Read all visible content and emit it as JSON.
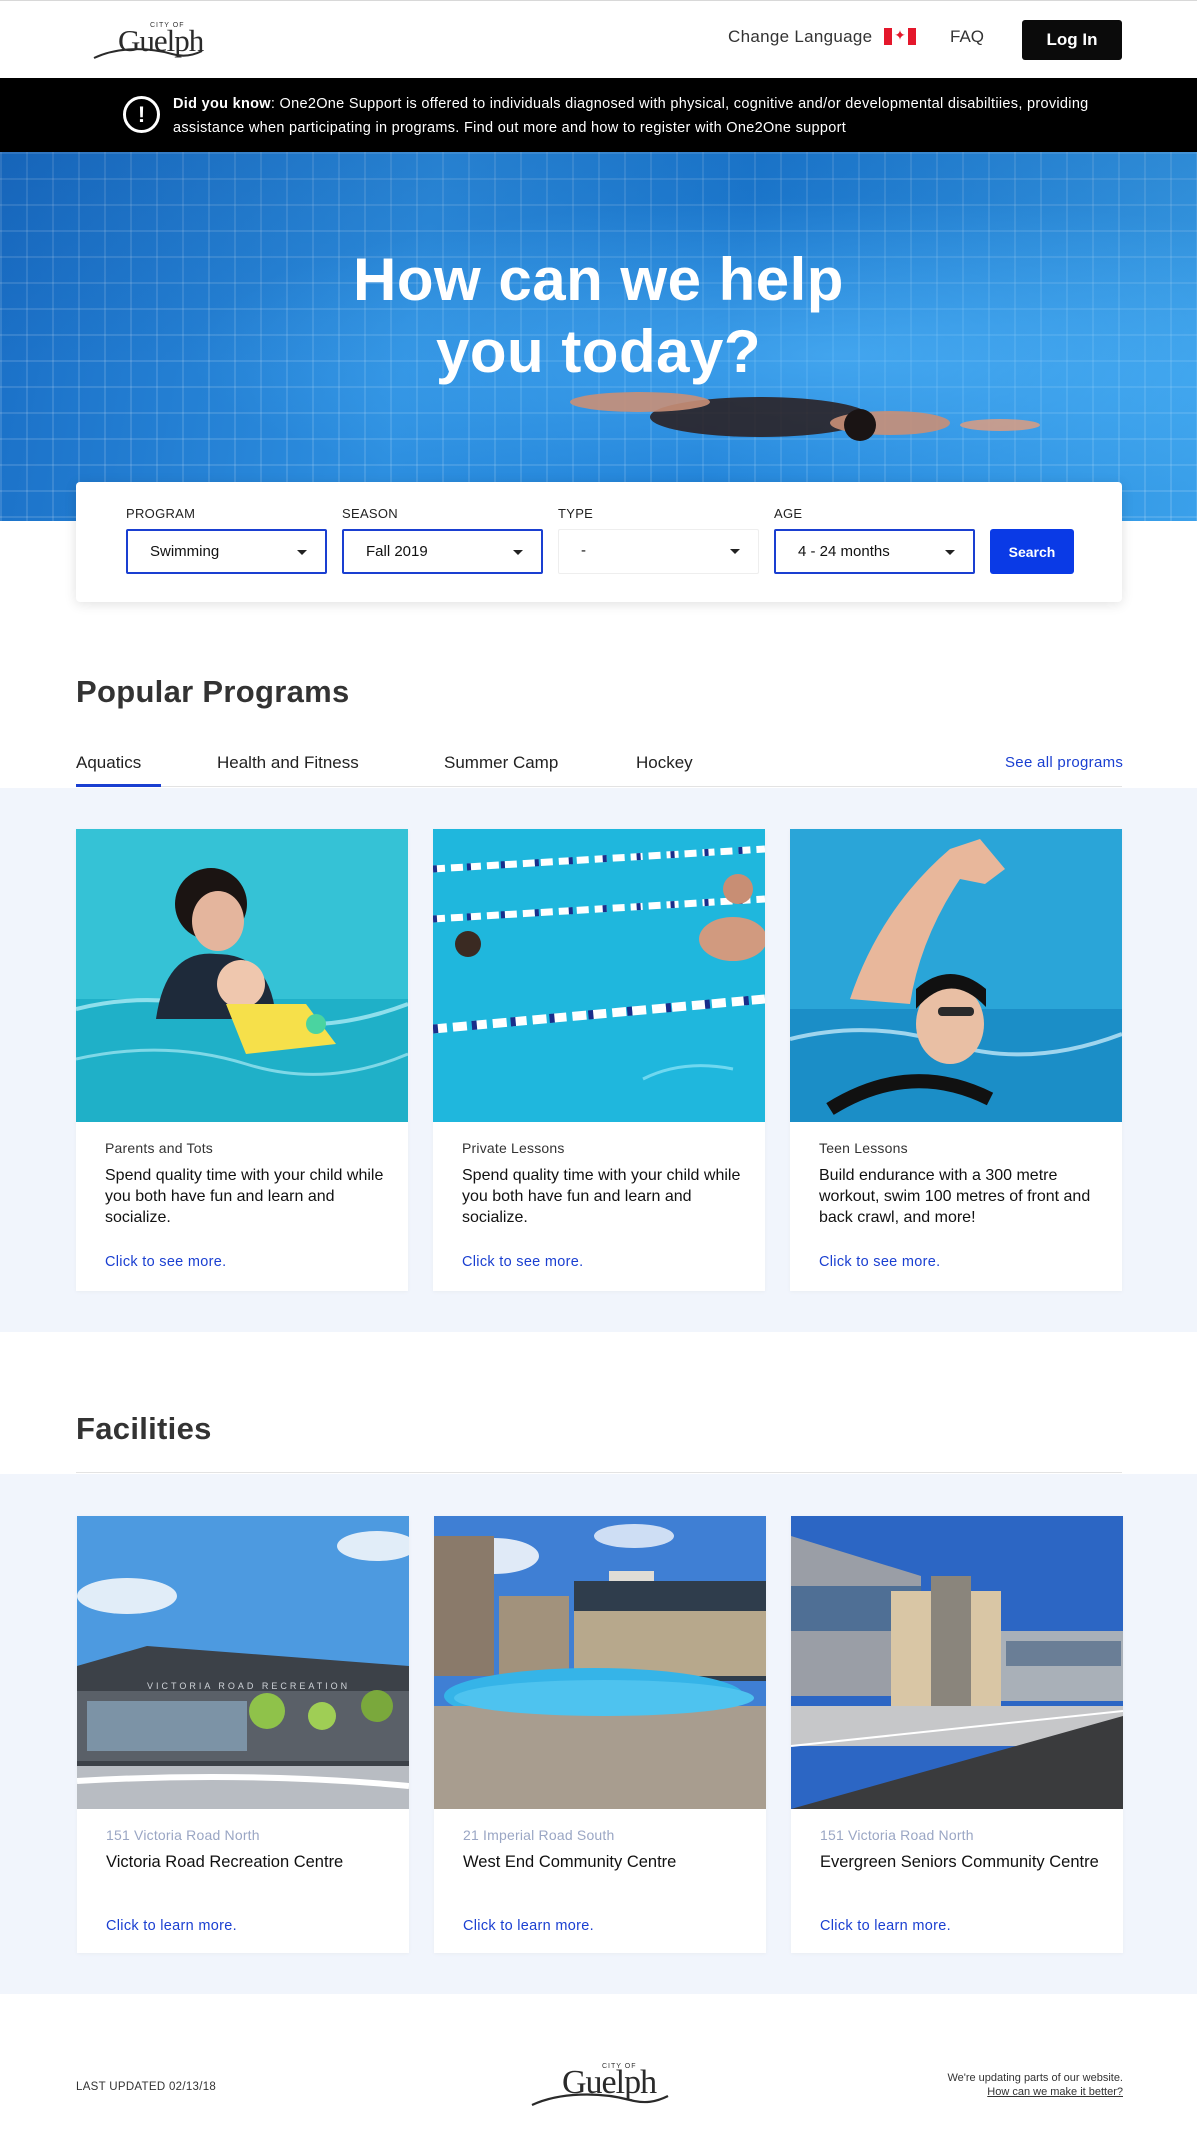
{
  "header": {
    "logo_small": "CITY OF",
    "logo_word": "Guelph",
    "change_language": "Change Language",
    "faq": "FAQ",
    "login": "Log In"
  },
  "notice": {
    "lead": "Did you know",
    "text": ": One2One Support is offered to individuals diagnosed with physical, cognitive and/or developmental disabiltiies, providing assistance when participating in programs. Find out more and how to register with One2One support"
  },
  "hero": {
    "title_line1": "How can we help",
    "title_line2": "you today?"
  },
  "search": {
    "program_label": "PROGRAM",
    "program_value": "Swimming",
    "season_label": "SEASON",
    "season_value": "Fall 2019",
    "type_label": "TYPE",
    "type_value": "-",
    "age_label": "AGE",
    "age_value": "4 - 24 months",
    "button": "Search"
  },
  "programs": {
    "title": "Popular Programs",
    "tabs": [
      "Aquatics",
      "Health and Fitness",
      "Summer Camp",
      "Hockey"
    ],
    "active_tab": "Aquatics",
    "see_all": "See all programs",
    "cards": [
      {
        "kicker": "Parents and Tots",
        "desc": "Spend quality time with your child while you both have fun and learn and socialize.",
        "more": "Click to see more."
      },
      {
        "kicker": "Private Lessons",
        "desc": "Spend quality time with your child while you both have fun and learn and socialize.",
        "more": "Click to see more."
      },
      {
        "kicker": "Teen Lessons",
        "desc": "Build endurance with a 300 metre workout, swim 100 metres of front and back crawl, and more!",
        "more": "Click to see more."
      }
    ]
  },
  "facilities": {
    "title": "Facilities",
    "cards": [
      {
        "address": "151 Victoria Road North",
        "name": "Victoria Road Recreation Centre",
        "more": "Click to learn more.",
        "sign": "VICTORIA ROAD RECREATION"
      },
      {
        "address": "21 Imperial Road South",
        "name": "West End Community Centre",
        "more": "Click to learn more."
      },
      {
        "address": "151 Victoria Road North",
        "name": "Evergreen Seniors Community Centre",
        "more": "Click to learn more."
      }
    ]
  },
  "footer": {
    "updated": "LAST UPDATED 02/13/18",
    "note": "We're updating parts of our website.",
    "feedback_link": "How can we make it better?"
  },
  "colors": {
    "accent": "#1a3fd1",
    "button_blue": "#0a3ae6",
    "notice_bg": "#000000",
    "band_bg": "#f1f5fc"
  }
}
